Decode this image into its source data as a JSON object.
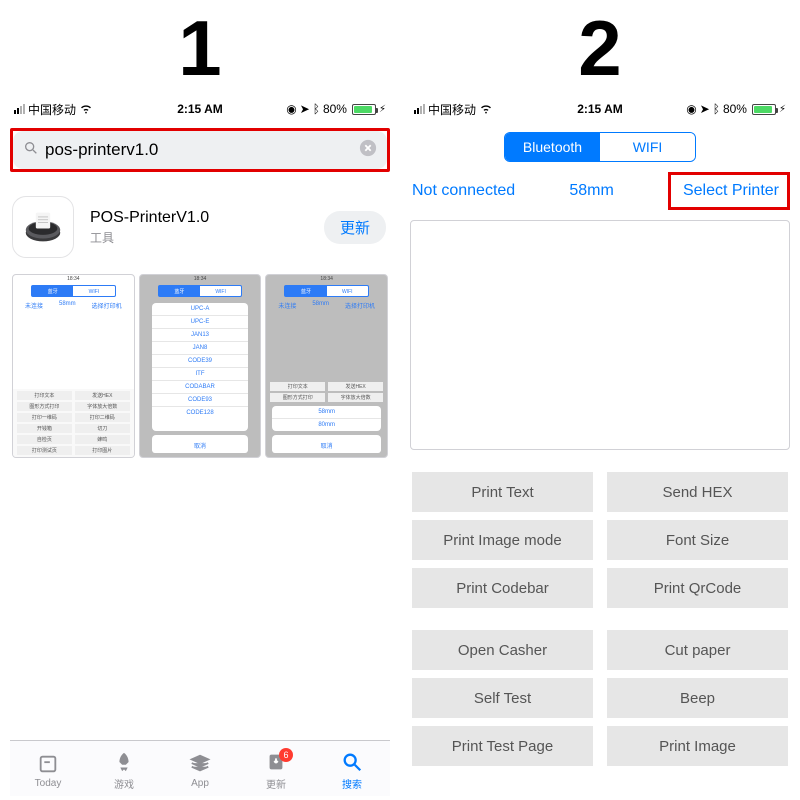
{
  "steps": {
    "one": "1",
    "two": "2"
  },
  "status": {
    "carrier": "中国移动",
    "time": "2:15 AM",
    "battery_pct": "80%"
  },
  "panel1": {
    "search": {
      "value": "pos-printerv1.0"
    },
    "app": {
      "title": "POS-PrinterV1.0",
      "category": "工具",
      "action": "更新"
    },
    "shots": {
      "s1": {
        "seg_on": "蓝牙",
        "seg_off": "WIFI",
        "tag_left": "未连接",
        "tag_mid": "58mm",
        "tag_right": "选择打印机",
        "b1": "打印文本",
        "b2": "发送HEX",
        "b3": "图形方式打印",
        "b4": "字体放大倍数",
        "b5": "打印一维码",
        "b6": "打印二维码",
        "b7": "开钱箱",
        "b8": "切刀",
        "b9": "自检页",
        "b10": "蜂鸣",
        "b11": "打印测试页",
        "b12": "打印图片"
      },
      "s2": {
        "seg_on": "蓝牙",
        "seg_off": "WIFI",
        "opts": [
          "UPC-A",
          "UPC-E",
          "JAN13",
          "JAN8",
          "CODE39",
          "ITF",
          "CODABAR",
          "CODE93",
          "CODE128"
        ],
        "cancel": "取消"
      },
      "s3": {
        "seg_on": "蓝牙",
        "seg_off": "WIFI",
        "tag_left": "未连接",
        "tag_mid": "58mm",
        "tag_right": "选择打印机",
        "b1": "打印文本",
        "b2": "发送HEX",
        "b3": "图形方式打印",
        "b4": "字体放大倍数",
        "opt1": "58mm",
        "opt2": "80mm",
        "cancel": "取消"
      }
    },
    "tabs": {
      "today": "Today",
      "games": "游戏",
      "app": "App",
      "updates": "更新",
      "updates_badge": "6",
      "search": "搜索"
    }
  },
  "panel2": {
    "seg": {
      "bt": "Bluetooth",
      "wifi": "WIFI"
    },
    "conn": {
      "status": "Not connected",
      "size": "58mm",
      "select": "Select Printer"
    },
    "buttons": {
      "r1a": "Print Text",
      "r1b": "Send HEX",
      "r2a": "Print Image mode",
      "r2b": "Font Size",
      "r3a": "Print Codebar",
      "r3b": "Print QrCode",
      "r4a": "Open Casher",
      "r4b": "Cut paper",
      "r5a": "Self Test",
      "r5b": "Beep",
      "r6a": "Print Test Page",
      "r6b": "Print Image"
    }
  }
}
